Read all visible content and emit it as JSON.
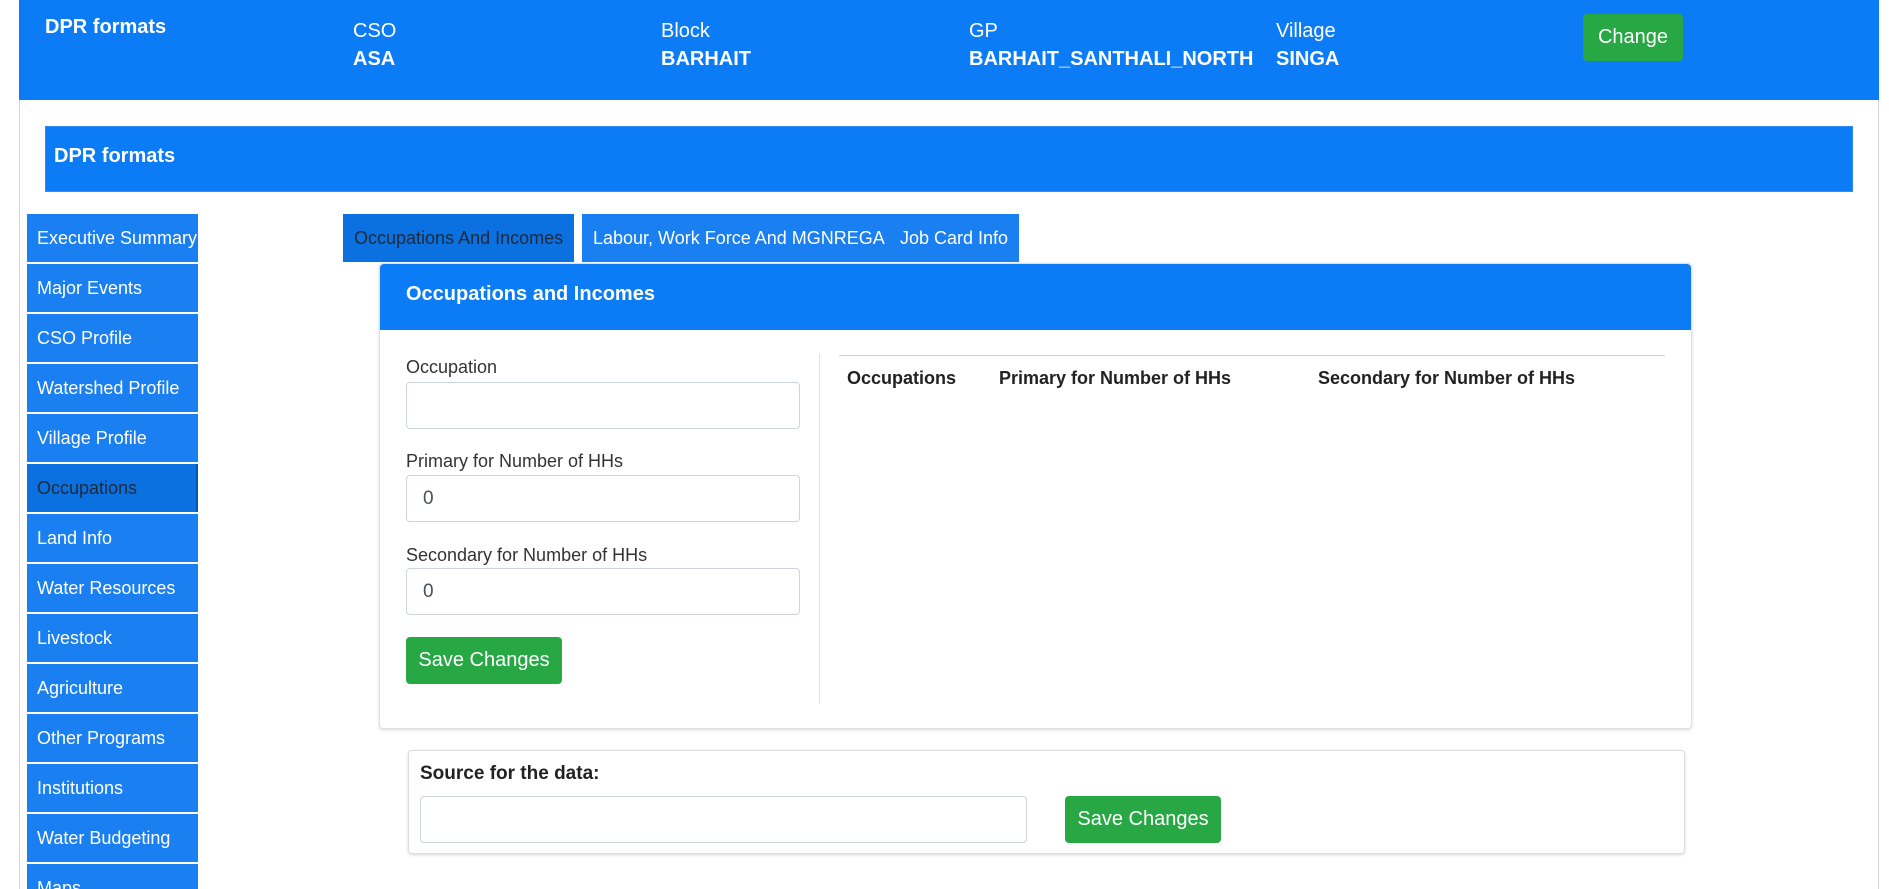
{
  "topbar": {
    "brand": "DPR formats",
    "fields": [
      {
        "label": "CSO",
        "value": "ASA"
      },
      {
        "label": "Block",
        "value": "BARHAIT"
      },
      {
        "label": "GP",
        "value": "BARHAIT_SANTHALI_NORTH"
      },
      {
        "label": "Village",
        "value": "SINGA"
      }
    ],
    "change_label": "Change"
  },
  "banner": {
    "title": "DPR formats"
  },
  "sidebar": {
    "items": [
      {
        "label": "Executive Summary"
      },
      {
        "label": "Major Events"
      },
      {
        "label": "CSO Profile"
      },
      {
        "label": "Watershed Profile"
      },
      {
        "label": "Village Profile"
      },
      {
        "label": "Occupations",
        "active": true
      },
      {
        "label": "Land Info"
      },
      {
        "label": "Water Resources"
      },
      {
        "label": "Livestock"
      },
      {
        "label": "Agriculture"
      },
      {
        "label": "Other Programs"
      },
      {
        "label": "Institutions"
      },
      {
        "label": "Water Budgeting"
      },
      {
        "label": "Maps"
      }
    ]
  },
  "tabs": [
    {
      "label": "Occupations And Incomes",
      "active": true
    },
    {
      "label": "Labour, Work Force And MGNREGA"
    },
    {
      "label": "Job Card Info"
    }
  ],
  "card": {
    "title": "Occupations and Incomes",
    "form": {
      "occupation_label": "Occupation",
      "occupation_value": "",
      "primary_label": "Primary for Number of HHs",
      "primary_value": "0",
      "secondary_label": "Secondary for Number of HHs",
      "secondary_value": "0",
      "save_label": "Save Changes"
    },
    "table": {
      "columns": [
        "Occupations",
        "Primary for Number of HHs",
        "Secondary for Number of HHs"
      ],
      "rows": []
    }
  },
  "source": {
    "label": "Source for the data:",
    "value": "",
    "save_label": "Save Changes"
  },
  "colors": {
    "primary_blue": "#0b7cf6",
    "success_green": "#28a745"
  }
}
